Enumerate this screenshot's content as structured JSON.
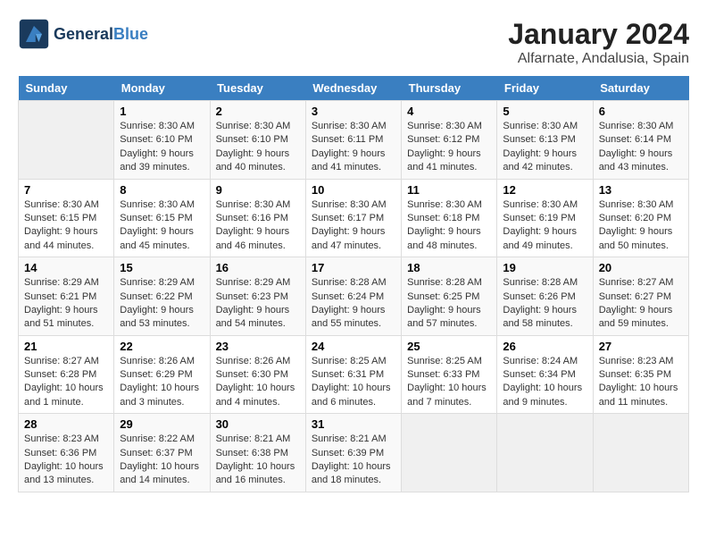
{
  "header": {
    "logo_line1": "General",
    "logo_line2": "Blue",
    "title": "January 2024",
    "subtitle": "Alfarnate, Andalusia, Spain"
  },
  "calendar": {
    "days_of_week": [
      "Sunday",
      "Monday",
      "Tuesday",
      "Wednesday",
      "Thursday",
      "Friday",
      "Saturday"
    ],
    "weeks": [
      [
        {
          "day": "",
          "info": ""
        },
        {
          "day": "1",
          "info": "Sunrise: 8:30 AM\nSunset: 6:10 PM\nDaylight: 9 hours\nand 39 minutes."
        },
        {
          "day": "2",
          "info": "Sunrise: 8:30 AM\nSunset: 6:10 PM\nDaylight: 9 hours\nand 40 minutes."
        },
        {
          "day": "3",
          "info": "Sunrise: 8:30 AM\nSunset: 6:11 PM\nDaylight: 9 hours\nand 41 minutes."
        },
        {
          "day": "4",
          "info": "Sunrise: 8:30 AM\nSunset: 6:12 PM\nDaylight: 9 hours\nand 41 minutes."
        },
        {
          "day": "5",
          "info": "Sunrise: 8:30 AM\nSunset: 6:13 PM\nDaylight: 9 hours\nand 42 minutes."
        },
        {
          "day": "6",
          "info": "Sunrise: 8:30 AM\nSunset: 6:14 PM\nDaylight: 9 hours\nand 43 minutes."
        }
      ],
      [
        {
          "day": "7",
          "info": "Sunrise: 8:30 AM\nSunset: 6:15 PM\nDaylight: 9 hours\nand 44 minutes."
        },
        {
          "day": "8",
          "info": "Sunrise: 8:30 AM\nSunset: 6:15 PM\nDaylight: 9 hours\nand 45 minutes."
        },
        {
          "day": "9",
          "info": "Sunrise: 8:30 AM\nSunset: 6:16 PM\nDaylight: 9 hours\nand 46 minutes."
        },
        {
          "day": "10",
          "info": "Sunrise: 8:30 AM\nSunset: 6:17 PM\nDaylight: 9 hours\nand 47 minutes."
        },
        {
          "day": "11",
          "info": "Sunrise: 8:30 AM\nSunset: 6:18 PM\nDaylight: 9 hours\nand 48 minutes."
        },
        {
          "day": "12",
          "info": "Sunrise: 8:30 AM\nSunset: 6:19 PM\nDaylight: 9 hours\nand 49 minutes."
        },
        {
          "day": "13",
          "info": "Sunrise: 8:30 AM\nSunset: 6:20 PM\nDaylight: 9 hours\nand 50 minutes."
        }
      ],
      [
        {
          "day": "14",
          "info": "Sunrise: 8:29 AM\nSunset: 6:21 PM\nDaylight: 9 hours\nand 51 minutes."
        },
        {
          "day": "15",
          "info": "Sunrise: 8:29 AM\nSunset: 6:22 PM\nDaylight: 9 hours\nand 53 minutes."
        },
        {
          "day": "16",
          "info": "Sunrise: 8:29 AM\nSunset: 6:23 PM\nDaylight: 9 hours\nand 54 minutes."
        },
        {
          "day": "17",
          "info": "Sunrise: 8:28 AM\nSunset: 6:24 PM\nDaylight: 9 hours\nand 55 minutes."
        },
        {
          "day": "18",
          "info": "Sunrise: 8:28 AM\nSunset: 6:25 PM\nDaylight: 9 hours\nand 57 minutes."
        },
        {
          "day": "19",
          "info": "Sunrise: 8:28 AM\nSunset: 6:26 PM\nDaylight: 9 hours\nand 58 minutes."
        },
        {
          "day": "20",
          "info": "Sunrise: 8:27 AM\nSunset: 6:27 PM\nDaylight: 9 hours\nand 59 minutes."
        }
      ],
      [
        {
          "day": "21",
          "info": "Sunrise: 8:27 AM\nSunset: 6:28 PM\nDaylight: 10 hours\nand 1 minute."
        },
        {
          "day": "22",
          "info": "Sunrise: 8:26 AM\nSunset: 6:29 PM\nDaylight: 10 hours\nand 3 minutes."
        },
        {
          "day": "23",
          "info": "Sunrise: 8:26 AM\nSunset: 6:30 PM\nDaylight: 10 hours\nand 4 minutes."
        },
        {
          "day": "24",
          "info": "Sunrise: 8:25 AM\nSunset: 6:31 PM\nDaylight: 10 hours\nand 6 minutes."
        },
        {
          "day": "25",
          "info": "Sunrise: 8:25 AM\nSunset: 6:33 PM\nDaylight: 10 hours\nand 7 minutes."
        },
        {
          "day": "26",
          "info": "Sunrise: 8:24 AM\nSunset: 6:34 PM\nDaylight: 10 hours\nand 9 minutes."
        },
        {
          "day": "27",
          "info": "Sunrise: 8:23 AM\nSunset: 6:35 PM\nDaylight: 10 hours\nand 11 minutes."
        }
      ],
      [
        {
          "day": "28",
          "info": "Sunrise: 8:23 AM\nSunset: 6:36 PM\nDaylight: 10 hours\nand 13 minutes."
        },
        {
          "day": "29",
          "info": "Sunrise: 8:22 AM\nSunset: 6:37 PM\nDaylight: 10 hours\nand 14 minutes."
        },
        {
          "day": "30",
          "info": "Sunrise: 8:21 AM\nSunset: 6:38 PM\nDaylight: 10 hours\nand 16 minutes."
        },
        {
          "day": "31",
          "info": "Sunrise: 8:21 AM\nSunset: 6:39 PM\nDaylight: 10 hours\nand 18 minutes."
        },
        {
          "day": "",
          "info": ""
        },
        {
          "day": "",
          "info": ""
        },
        {
          "day": "",
          "info": ""
        }
      ]
    ]
  }
}
